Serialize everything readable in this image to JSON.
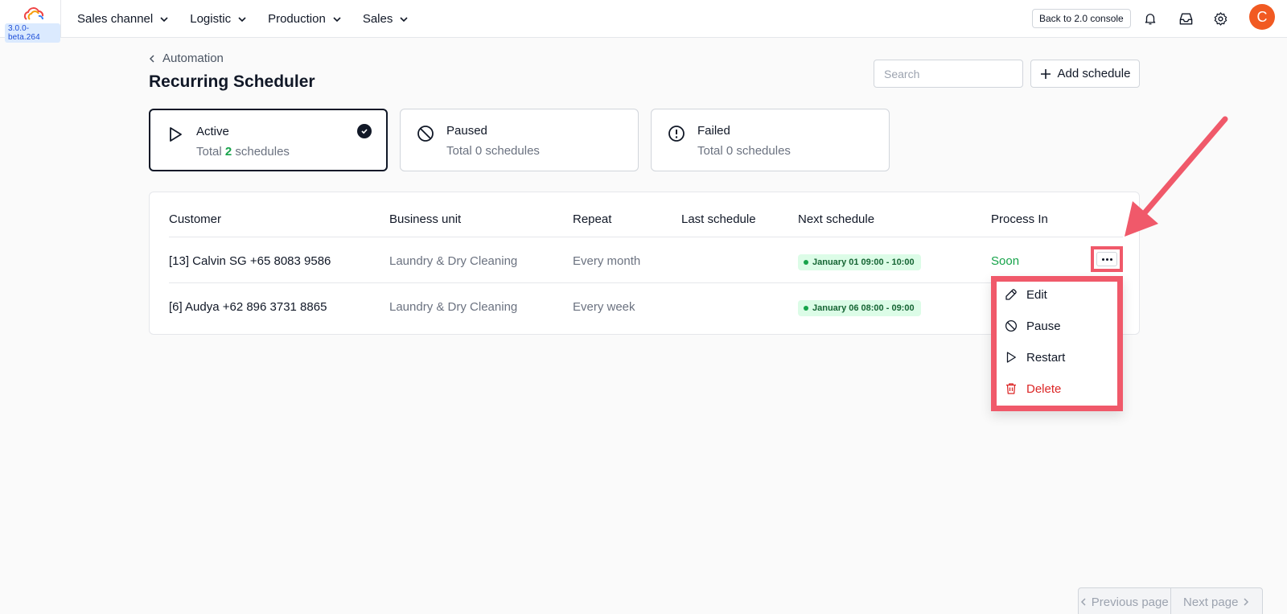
{
  "app": {
    "version": "3.0.0-beta.264"
  },
  "nav": {
    "items": [
      {
        "label": "Sales channel"
      },
      {
        "label": "Logistic"
      },
      {
        "label": "Production"
      },
      {
        "label": "Sales"
      }
    ]
  },
  "topbar": {
    "console_button": "Back to 2.0 console",
    "avatar_initial": "C",
    "avatar_color": "#f15a22"
  },
  "breadcrumb": {
    "parent": "Automation"
  },
  "page": {
    "title": "Recurring Scheduler"
  },
  "search": {
    "placeholder": "Search"
  },
  "add_schedule": {
    "label": "Add schedule"
  },
  "status_cards": [
    {
      "title": "Active",
      "prefix": "Total",
      "count": "2",
      "suffix": "schedules",
      "selected": true,
      "icon": "play-icon"
    },
    {
      "title": "Paused",
      "subtitle": "Total 0 schedules",
      "selected": false,
      "icon": "ban-icon"
    },
    {
      "title": "Failed",
      "subtitle": "Total 0 schedules",
      "selected": false,
      "icon": "alert-circle-icon"
    }
  ],
  "table": {
    "columns": [
      "Customer",
      "Business unit",
      "Repeat",
      "Last schedule",
      "Next schedule",
      "Process In"
    ],
    "rows": [
      {
        "customer": "[13] Calvin SG +65 8083 9586",
        "business_unit": "Laundry & Dry Cleaning",
        "repeat": "Every month",
        "last_schedule": "",
        "next_schedule": "January 01 09:00 - 10:00",
        "process_in": "Soon"
      },
      {
        "customer": "[6] Audya +62 896 3731 8865",
        "business_unit": "Laundry & Dry Cleaning",
        "repeat": "Every week",
        "last_schedule": "",
        "next_schedule": "January 06 08:00 - 09:00",
        "process_in": ""
      }
    ]
  },
  "row_menu": {
    "items": [
      {
        "label": "Edit",
        "icon": "edit-icon"
      },
      {
        "label": "Pause",
        "icon": "ban-icon"
      },
      {
        "label": "Restart",
        "icon": "play-icon"
      },
      {
        "label": "Delete",
        "icon": "trash-icon",
        "color": "#dc2626"
      }
    ]
  },
  "pagination": {
    "previous": "Previous page",
    "next": "Next page"
  },
  "colors": {
    "accent_highlight": "#f0596a",
    "success": "#16a34a"
  }
}
